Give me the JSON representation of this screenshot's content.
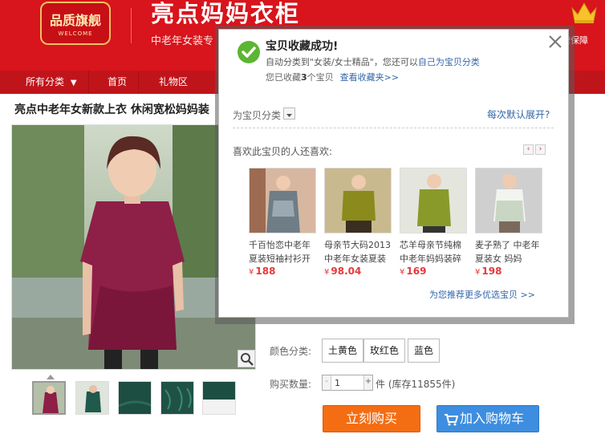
{
  "header": {
    "logo_main": "品质旗舰",
    "logo_sub": "WELCOME",
    "shop_name": "亮点妈妈衣柜",
    "shop_subtitle": "中老年女装专",
    "guarantee_text": "营保障"
  },
  "nav": {
    "items": [
      {
        "label": "所有分类"
      },
      {
        "label": "首页"
      },
      {
        "label": "礼物区"
      }
    ]
  },
  "product": {
    "title": "亮点中老年女新款上衣 休闲宽松妈妈装",
    "color_label": "颜色分类:",
    "colors": [
      "土黄色",
      "玫红色",
      "蓝色"
    ],
    "qty_label": "购买数量:",
    "qty_value": "1",
    "stock_text": "件 (库存11855件)",
    "buy_label": "立刻购买",
    "cart_label": "加入购物车"
  },
  "popup": {
    "title": "宝贝收藏成功!",
    "line2_prefix": "自动分类到\"女装/女士精品\"，您还可以",
    "line2_link": "自己为宝贝分类",
    "line3_prefix": "您已收藏",
    "line3_count": "3",
    "line3_suffix": "个宝贝",
    "line3_link": "查看收藏夹>>",
    "category_label": "为宝贝分类",
    "expand_link": "每次默认展开?",
    "also_label": "喜欢此宝贝的人还喜欢:",
    "more_link": "为您推荐更多优选宝贝 >>",
    "currency": "¥",
    "recommendations": [
      {
        "title": "千百怡恋中老年夏装短袖衬衫开",
        "price": "188"
      },
      {
        "title": "母亲节大码2013中老年女装夏装",
        "price": "98.04"
      },
      {
        "title": "芯羊母亲节纯棉中老年妈妈装碎",
        "price": "169"
      },
      {
        "title": "麦子熟了 中老年夏装女 妈妈",
        "price": "198"
      }
    ]
  },
  "colors": {
    "header_red": "#d8141c",
    "nav_red": "#c0141b",
    "buy_orange": "#f46d13",
    "cart_blue": "#3d8ee0",
    "price_red": "#e4393c",
    "link_blue": "#3366aa"
  }
}
